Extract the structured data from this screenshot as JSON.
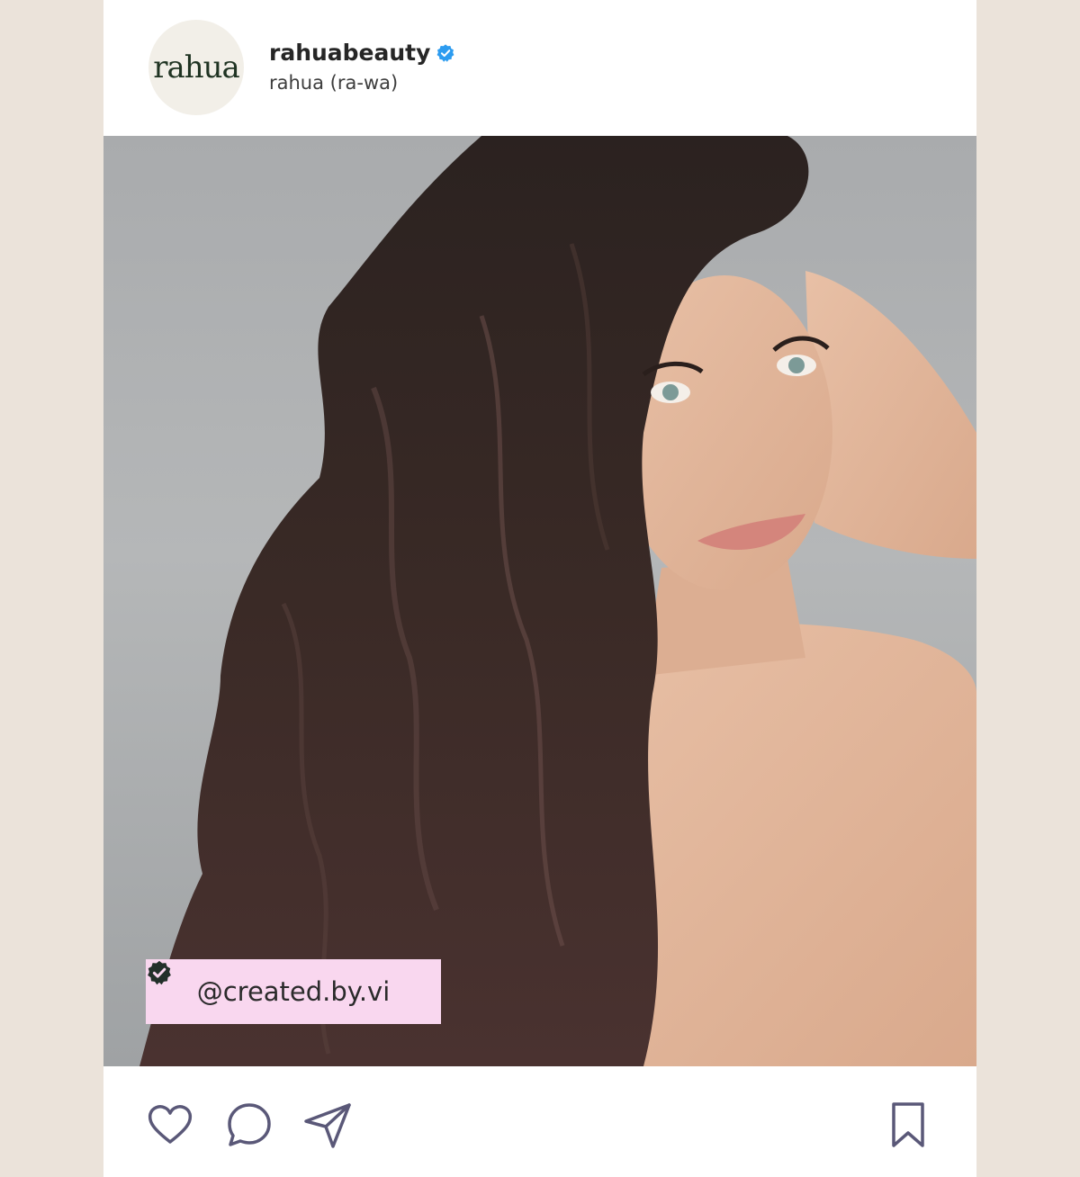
{
  "post": {
    "account": {
      "avatar_text": "rahua",
      "username": "rahuabeauty",
      "subtitle": "rahua (ra-wa)",
      "verified_icon": "verified-badge-icon"
    },
    "media": {
      "description_icon": "photo",
      "credit_tag": "@created.by.vi",
      "credit_icon": "verified-seal-icon"
    },
    "actions": {
      "like_icon": "heart-icon",
      "comment_icon": "comment-icon",
      "share_icon": "send-icon",
      "save_icon": "bookmark-icon"
    }
  },
  "colors": {
    "background": "#ebe3da",
    "card": "#ffffff",
    "verified_blue": "#2d9cf0",
    "credit_pink": "#f9d7ef",
    "icon_stroke": "#5a5878"
  }
}
